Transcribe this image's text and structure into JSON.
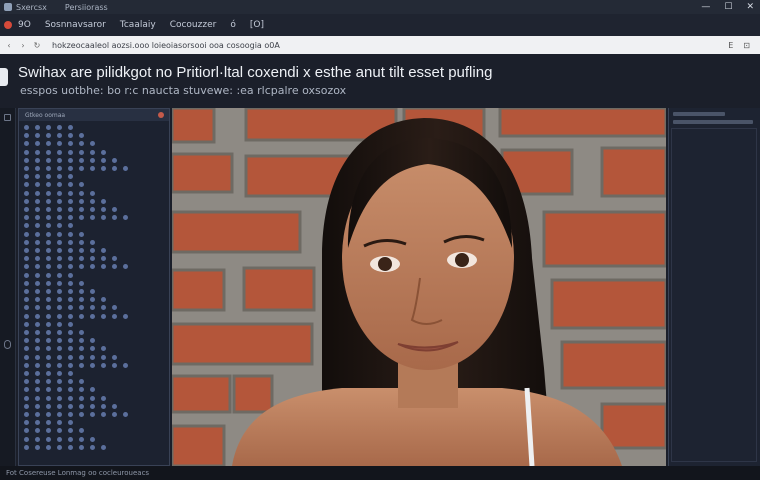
{
  "titlebar": {
    "items": [
      "Sxercsx",
      "Persiiorass"
    ],
    "controls": [
      "—",
      "☐",
      "✕"
    ]
  },
  "tabbar": {
    "tabs": [
      "9O",
      "Sosnnavsaror",
      "Tcaalaiy",
      "Cocouzzer",
      "ó",
      "[O]"
    ]
  },
  "addressbar": {
    "url": "hokzeocaaleol aozsi.ooo loieoiasorsooi ooa cosoogia o0A",
    "icons": [
      "E",
      "⊡"
    ]
  },
  "header": {
    "title": "Swihax are pilidkgot no Pritiorl·ltal coxendi x esthe anut tilt esset pufling",
    "subtitle": "esspos uotbhe: bo r:c naucta stuvewe: :ea rlcpalre oxsozox"
  },
  "leftpanel": {
    "heading": "Gtkeo oomaa"
  },
  "statusbar": {
    "text": "Fot Cosereuse Lonmag oo cocleuroueacs"
  },
  "colors": {
    "background": "#1b1f2a",
    "panel": "#1c2230",
    "accent_dot": "#5b6f9c",
    "brick": "#b4563a",
    "mortar": "#8e8a84"
  }
}
